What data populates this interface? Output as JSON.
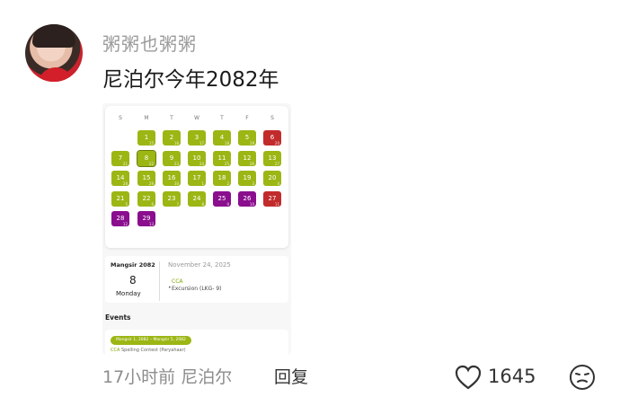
{
  "comment": {
    "username": "粥粥也粥粥",
    "text": "尼泊尔今年2082年",
    "time": "17小时前",
    "location": "尼泊尔",
    "reply_label": "回复",
    "likes": "1645"
  },
  "screenshot": {
    "weekdays": [
      "S",
      "M",
      "T",
      "W",
      "T",
      "F",
      "S"
    ],
    "days": [
      {
        "n": "1",
        "s": "g",
        "sub": "15"
      },
      {
        "n": "2",
        "s": "g",
        "sub": "16"
      },
      {
        "n": "3",
        "s": "g",
        "sub": "17"
      },
      {
        "n": "4",
        "s": "g",
        "sub": "18"
      },
      {
        "n": "5",
        "s": "g",
        "sub": "19"
      },
      {
        "n": "6",
        "s": "r",
        "sub": "20"
      },
      {
        "n": "7",
        "s": "g",
        "sub": "21"
      },
      {
        "n": "8",
        "s": "g",
        "sub": "22"
      },
      {
        "n": "9",
        "s": "g",
        "sub": "23"
      },
      {
        "n": "10",
        "s": "g",
        "sub": "24"
      },
      {
        "n": "11",
        "s": "g",
        "sub": "25"
      },
      {
        "n": "12",
        "s": "g",
        "sub": "26"
      },
      {
        "n": "13",
        "s": "g",
        "sub": "27"
      },
      {
        "n": "14",
        "s": "g",
        "sub": "28"
      },
      {
        "n": "15",
        "s": "g",
        "sub": "29"
      },
      {
        "n": "16",
        "s": "g",
        "sub": "30"
      },
      {
        "n": "17",
        "s": "g",
        "sub": "1"
      },
      {
        "n": "18",
        "s": "g",
        "sub": "2"
      },
      {
        "n": "19",
        "s": "g",
        "sub": "3"
      },
      {
        "n": "20",
        "s": "g",
        "sub": "4"
      },
      {
        "n": "21",
        "s": "g",
        "sub": "5"
      },
      {
        "n": "22",
        "s": "g",
        "sub": "6"
      },
      {
        "n": "23",
        "s": "g",
        "sub": "7"
      },
      {
        "n": "24",
        "s": "g",
        "sub": "8"
      },
      {
        "n": "25",
        "s": "p",
        "sub": "9"
      },
      {
        "n": "26",
        "s": "p",
        "sub": "10"
      },
      {
        "n": "27",
        "s": "r",
        "sub": "11"
      },
      {
        "n": "28",
        "s": "p",
        "sub": "12"
      },
      {
        "n": "29",
        "s": "p",
        "sub": "13"
      }
    ],
    "month_label": "Mangsir 2082",
    "selected_day": "8",
    "selected_weekday": "Monday",
    "selected_date": "November 24, 2025",
    "event_tag": "CCA",
    "event_detail": "Excursion (LKG- 9)",
    "events_heading": "Events",
    "event_range": "Mangsir 1, 2082  –  Mangsir 5, 2082",
    "event_cca": "CCA",
    "event_text": "Spelling Contest (Paryahaar)"
  },
  "colors": {
    "green": "#9cb614",
    "purple": "#8a0e8e",
    "red": "#c22b2b"
  }
}
